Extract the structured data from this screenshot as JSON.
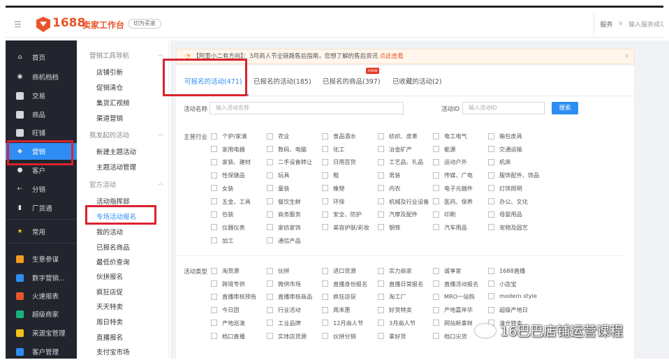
{
  "header": {
    "logo_number": "1688",
    "logo_title": "卖家工作台",
    "switch_label": "切为买家",
    "service_label": "服务",
    "search_placeholder": "输入服务成功"
  },
  "nav": {
    "items": [
      {
        "label": "首页",
        "icon": "home-icon"
      },
      {
        "label": "商机档档",
        "icon": "hand-coin-icon"
      },
      {
        "label": "交易",
        "icon": "doc-icon"
      },
      {
        "label": "商品",
        "icon": "box-icon"
      },
      {
        "label": "旺铺",
        "icon": "shop-icon"
      },
      {
        "label": "营销",
        "icon": "tag-icon"
      },
      {
        "label": "客户",
        "icon": "user-icon"
      },
      {
        "label": "分销",
        "icon": "share-icon"
      },
      {
        "label": "厂货通",
        "icon": "chart-icon"
      },
      {
        "label": "常用",
        "icon": "star-icon"
      },
      {
        "label": "生意参谋",
        "icon": "analytics-icon"
      },
      {
        "label": "数字营销...",
        "icon": "digital-icon"
      },
      {
        "label": "火速报表",
        "icon": "fire-icon"
      },
      {
        "label": "超级商家",
        "icon": "crown-icon"
      },
      {
        "label": "采源宝管理",
        "icon": "source-icon"
      },
      {
        "label": "客户管理",
        "icon": "crm-icon"
      }
    ],
    "active_label": "营销"
  },
  "submenu": {
    "group1_title": "营销工具导航",
    "group1_items": [
      "店铺引新",
      "促销清仓",
      "集货汇视频",
      "渠道营销"
    ],
    "group2_title": "我发起的活动",
    "group2_items": [
      "新建主题活动",
      "主题活动管理"
    ],
    "group3_title": "官方活动",
    "group3_items": [
      "活动指挥部",
      "专场活动报名",
      "我的活动",
      "已报名商品",
      "最低价查询",
      "伙拼报名",
      "疯狂店促",
      "天天特卖",
      "周日特卖",
      "直播报名",
      "支付宝市场"
    ]
  },
  "notice": {
    "text": "【阿里小二有方向】：3月商人节全链路售后指南，您想了解的售后资讯",
    "link": "点此查看"
  },
  "tabs": [
    {
      "label": "可报名的活动(471)"
    },
    {
      "label": "已报名的活动(185)"
    },
    {
      "label": "已报名的商品(397)"
    },
    {
      "label": "已收藏的活动(2)"
    }
  ],
  "tab_badge": "new",
  "filters": {
    "activity_name_label": "活动名称",
    "activity_name_placeholder": "输入活动名称",
    "activity_id_label": "活动ID",
    "activity_id_placeholder": "输入活动ID",
    "search_button": "搜索",
    "industry_label": "主营行业",
    "industry_options": [
      "个护/家清",
      "农业",
      "食品酒水",
      "纺织、皮革",
      "电工电气",
      "箱包皮具",
      "家用电器",
      "数码、电脑",
      "化工",
      "冶金矿产",
      "能源",
      "交通运输",
      "家装、建材",
      "二手设备转让",
      "日用百货",
      "工艺品、礼品",
      "运动户外",
      "机床",
      "性保健品",
      "玩具",
      "鞋",
      "男装",
      "传媒、广电",
      "服饰配件、饰品",
      "女装",
      "童装",
      "橡塑",
      "内衣",
      "电子元器件",
      "灯饰照明",
      "五金、工具",
      "餐饮生鲜",
      "环保",
      "机械及行业设备",
      "医药、保养",
      "办公、文化",
      "包装",
      "商务服务",
      "安全、防护",
      "汽摩及配件",
      "印刷",
      "母婴用品",
      "仪器仪表",
      "家纺家饰",
      "美容护肤/彩妆",
      "钢铁",
      "汽车用品",
      "宠物及园艺",
      "加工",
      "通信产品"
    ],
    "type_label": "活动类型",
    "type_options": [
      "淘货源",
      "伙拼",
      "进口货源",
      "实力商家",
      "诚享家",
      "1688直播",
      "跨境专供",
      "微供市场",
      "直播身份报名",
      "直播日常报名",
      "直播活动报名",
      "小店宝",
      "直播审核预告",
      "直播审核商品",
      "疯狂店促",
      "淘工厂",
      "MRO一站购",
      "modern style",
      "今日团",
      "行业活动",
      "周末惠",
      "好货特卖",
      "产地嘉年华",
      "超级产地日",
      "产地巡演",
      "工业品牌",
      "12月商人节",
      "3月商人节",
      "网站新拿样",
      "清仓特卖",
      "档口直播",
      "实体店货源",
      "伙拼分销",
      "拿好货",
      "档口尖货"
    ]
  },
  "watermark": "16巴巴店铺运营课程"
}
